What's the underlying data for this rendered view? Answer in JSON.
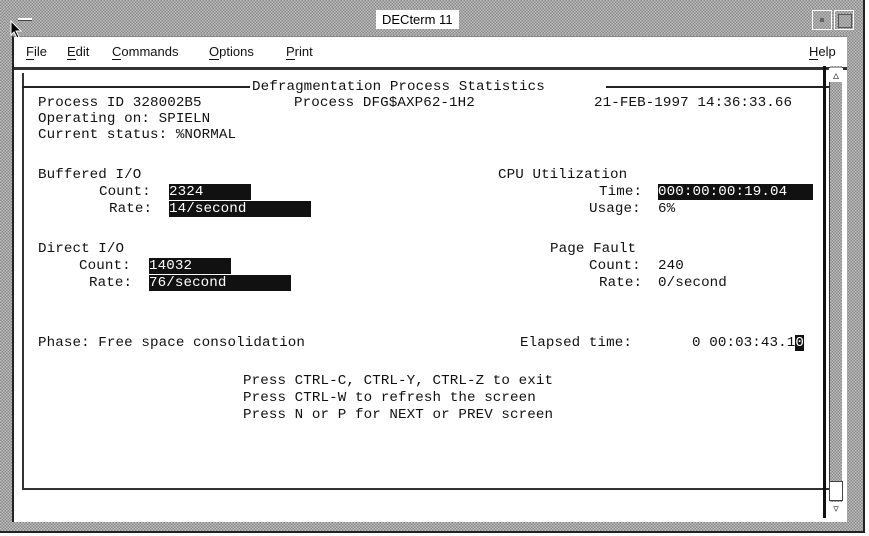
{
  "window": {
    "title": "DECterm 11"
  },
  "menubar": {
    "items": [
      {
        "label": "File",
        "mnemonic": "F",
        "rest": "ile"
      },
      {
        "label": "Edit",
        "mnemonic": "E",
        "rest": "dit"
      },
      {
        "label": "Commands",
        "mnemonic": "C",
        "rest": "ommands"
      },
      {
        "label": "Options",
        "mnemonic": "O",
        "rest": "ptions"
      },
      {
        "label": "Print",
        "mnemonic": "P",
        "rest": "rint"
      }
    ],
    "help": {
      "label": "Help",
      "mnemonic": "H",
      "rest": "elp"
    }
  },
  "screen": {
    "heading": "Defragmentation Process Statistics",
    "header": {
      "process_id": "Process ID 328002B5",
      "process_name": "Process DFG$AXP62-1H2",
      "timestamp": "21-FEB-1997 14:36:33.66",
      "operating_on": "Operating on: SPIELN",
      "current_status": "Current status: %NORMAL"
    },
    "buffered_io": {
      "title": "Buffered I/O",
      "count_label": "Count:",
      "count_value": "2324",
      "rate_label": "Rate:",
      "rate_value": "14/second"
    },
    "direct_io": {
      "title": "Direct I/O",
      "count_label": "Count:",
      "count_value": "14032",
      "rate_label": "Rate:",
      "rate_value": "76/second"
    },
    "cpu": {
      "title": "CPU Utilization",
      "time_label": "Time:",
      "time_value": "000:00:00:19.04",
      "usage_label": "Usage:",
      "usage_value": "6%"
    },
    "page_fault": {
      "title": "Page Fault",
      "count_label": "Count:",
      "count_value": "240",
      "rate_label": "Rate:",
      "rate_value": "0/second"
    },
    "phase": "Phase: Free space consolidation",
    "elapsed_label": "Elapsed time:",
    "elapsed_value": "0 00:03:43.1",
    "elapsed_cursor_char": "0",
    "instructions": [
      "Press CTRL-C, CTRL-Y, CTRL-Z to exit",
      "Press CTRL-W to refresh the screen",
      "Press N or P for NEXT or PREV screen"
    ]
  },
  "scrollbar": {
    "up_icon": "▵",
    "down_icon": "▿"
  }
}
